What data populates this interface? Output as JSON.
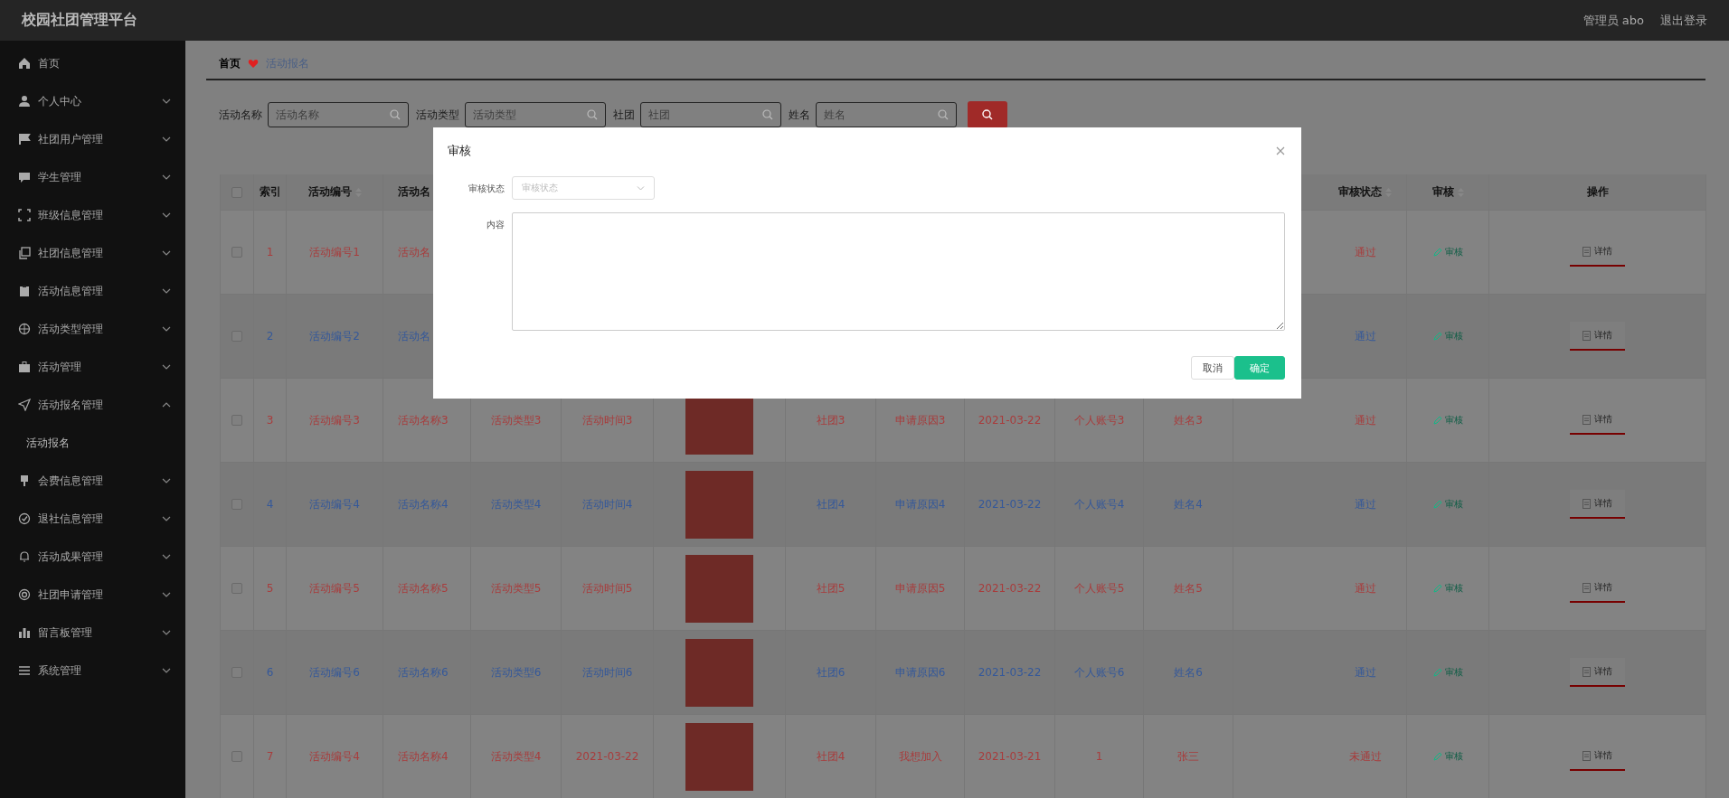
{
  "header": {
    "title": "校园社团管理平台",
    "user": "管理员 abo",
    "logout": "退出登录"
  },
  "sidebar": {
    "items": [
      {
        "label": "首页"
      },
      {
        "label": "个人中心",
        "expanded": false
      },
      {
        "label": "社团用户管理",
        "expanded": false
      },
      {
        "label": "学生管理",
        "expanded": false
      },
      {
        "label": "班级信息管理",
        "expanded": false
      },
      {
        "label": "社团信息管理",
        "expanded": false
      },
      {
        "label": "活动信息管理",
        "expanded": false
      },
      {
        "label": "活动类型管理",
        "expanded": false
      },
      {
        "label": "活动管理",
        "expanded": false
      },
      {
        "label": "活动报名管理",
        "expanded": true,
        "children": [
          {
            "label": "活动报名"
          }
        ]
      },
      {
        "label": "会费信息管理",
        "expanded": false
      },
      {
        "label": "退社信息管理",
        "expanded": false
      },
      {
        "label": "活动成果管理",
        "expanded": false
      },
      {
        "label": "社团申请管理",
        "expanded": false
      },
      {
        "label": "留言板管理",
        "expanded": false
      },
      {
        "label": "系统管理",
        "expanded": false
      }
    ]
  },
  "breadcrumb": [
    "首页",
    "活动报名"
  ],
  "search": {
    "fields": [
      {
        "label": "活动名称",
        "placeholder": "活动名称"
      },
      {
        "label": "活动类型",
        "placeholder": "活动类型"
      },
      {
        "label": "社团",
        "placeholder": "社团"
      },
      {
        "label": "姓名",
        "placeholder": "姓名"
      }
    ]
  },
  "table": {
    "header_checked": false,
    "columns": [
      {
        "label": "索引",
        "sortable": false,
        "kind": "text"
      },
      {
        "label": "活动编号",
        "sortable": true,
        "kind": "text"
      },
      {
        "label": "活动名",
        "sortable": false,
        "kind": "text"
      },
      {
        "kind": "text"
      },
      {
        "kind": "text"
      },
      {
        "kind": "photo"
      },
      {
        "kind": "text"
      },
      {
        "kind": "text"
      },
      {
        "kind": "text"
      },
      {
        "kind": "text"
      },
      {
        "kind": "text"
      },
      {
        "kind": "empty"
      },
      {
        "label": "审核状态",
        "sortable": true,
        "kind": "text"
      },
      {
        "label": "审核",
        "sortable": true,
        "kind": "review"
      },
      {
        "label": "操作",
        "sortable": false,
        "kind": "action"
      }
    ],
    "rows": [
      {
        "checked": false,
        "color": "#a83c3c",
        "cells": [
          "1",
          "活动编号1",
          "活动名",
          "",
          "",
          "",
          "",
          "",
          "",
          "",
          "",
          "",
          "通过",
          "审核",
          "详情"
        ]
      },
      {
        "checked": false,
        "color": "#34589a",
        "cells": [
          "2",
          "活动编号2",
          "活动名",
          "",
          "",
          "",
          "",
          "",
          "",
          "",
          "",
          "",
          "通过",
          "审核",
          "详情"
        ]
      },
      {
        "checked": false,
        "color": "#a83c3c",
        "cells": [
          "3",
          "活动编号3",
          "活动名称3",
          "活动类型3",
          "活动时间3",
          "",
          "社团3",
          "申请原因3",
          "2021-03-22",
          "个人账号3",
          "姓名3",
          "",
          "通过",
          "审核",
          "详情"
        ]
      },
      {
        "checked": false,
        "color": "#34589a",
        "cells": [
          "4",
          "活动编号4",
          "活动名称4",
          "活动类型4",
          "活动时间4",
          "",
          "社团4",
          "申请原因4",
          "2021-03-22",
          "个人账号4",
          "姓名4",
          "",
          "通过",
          "审核",
          "详情"
        ]
      },
      {
        "checked": false,
        "color": "#a83c3c",
        "cells": [
          "5",
          "活动编号5",
          "活动名称5",
          "活动类型5",
          "活动时间5",
          "",
          "社团5",
          "申请原因5",
          "2021-03-22",
          "个人账号5",
          "姓名5",
          "",
          "通过",
          "审核",
          "详情"
        ]
      },
      {
        "checked": false,
        "color": "#34589a",
        "cells": [
          "6",
          "活动编号6",
          "活动名称6",
          "活动类型6",
          "活动时间6",
          "",
          "社团6",
          "申请原因6",
          "2021-03-22",
          "个人账号6",
          "姓名6",
          "",
          "通过",
          "审核",
          "详情"
        ]
      },
      {
        "checked": false,
        "color": "#a83c3c",
        "cells": [
          "7",
          "活动编号4",
          "活动名称4",
          "活动类型4",
          "2021-03-22",
          "",
          "社团4",
          "我想加入",
          "2021-03-21",
          "1",
          "张三",
          "",
          "未通过",
          "审核",
          "详情"
        ]
      }
    ]
  },
  "dialog": {
    "title": "审核",
    "fields": [
      {
        "kind": "select",
        "label": "审核状态",
        "placeholder": "审核状态"
      },
      {
        "kind": "textarea",
        "label": "内容"
      }
    ],
    "buttons": [
      {
        "label": "取消",
        "primary": false
      },
      {
        "label": "确定",
        "primary": true
      }
    ]
  }
}
